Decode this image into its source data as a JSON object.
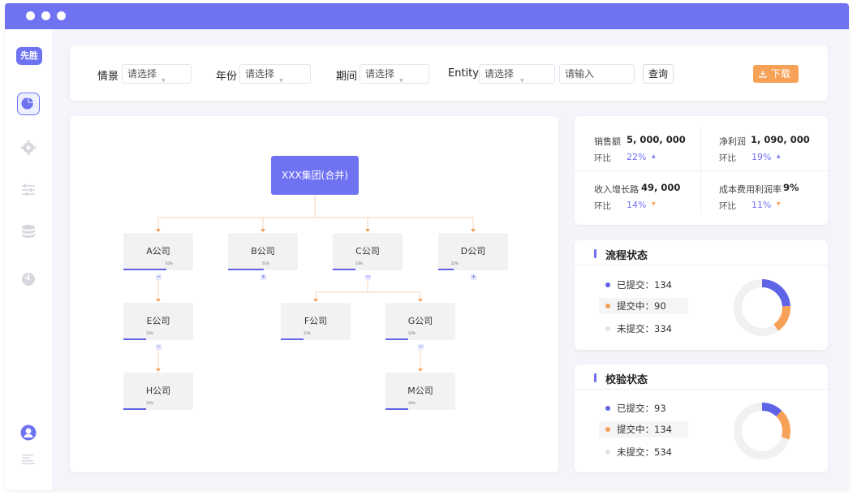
{
  "app": {
    "logo_text": "先胜"
  },
  "filters": {
    "scene_label": "情景",
    "scene_placeholder": "请选择",
    "year_label": "年份",
    "year_placeholder": "请选择",
    "period_label": "期间",
    "period_placeholder": "请选择",
    "entity_label": "Entity",
    "entity_placeholder": "请选择",
    "text_placeholder": "请输入",
    "query_label": "查询",
    "download_label": "下载"
  },
  "org": {
    "root": "XXX集团(合并)",
    "nodes": [
      {
        "id": "A",
        "label": "A公司",
        "pct_text": "62%",
        "progress": 0.62,
        "toggle": "−"
      },
      {
        "id": "B",
        "label": "B公司",
        "pct_text": "51%",
        "progress": 0.51,
        "toggle": "+"
      },
      {
        "id": "C",
        "label": "C公司",
        "pct_text": "33%",
        "progress": 0.33,
        "toggle": "−"
      },
      {
        "id": "D",
        "label": "D公司",
        "pct_text": "22%",
        "progress": 0.22,
        "toggle": "+"
      },
      {
        "id": "E",
        "label": "E公司",
        "pct_text": "33%",
        "progress": 0.33,
        "toggle": "−"
      },
      {
        "id": "F",
        "label": "F公司",
        "pct_text": "33%",
        "progress": 0.33
      },
      {
        "id": "G",
        "label": "G公司",
        "pct_text": "33%",
        "progress": 0.33,
        "toggle": "−"
      },
      {
        "id": "H",
        "label": "H公司",
        "pct_text": "33%",
        "progress": 0.33
      },
      {
        "id": "M",
        "label": "M公司",
        "pct_text": "33%",
        "progress": 0.33
      }
    ]
  },
  "metrics": {
    "sales": {
      "label": "销售额",
      "value": "5, 000, 000",
      "compare_label": "环比",
      "pct": "22%",
      "trend": "▲",
      "trend_color": "#6f73f2"
    },
    "net_profit": {
      "label": "净利润",
      "value": "1, 090, 000",
      "compare_label": "环比",
      "pct": "19%",
      "trend": "▲",
      "trend_color": "#6f73f2"
    },
    "revenue_growth": {
      "label": "收入增长路",
      "value": "49, 000",
      "compare_label": "环比",
      "pct": "14%",
      "trend": "▼",
      "trend_color": "#f7a157"
    },
    "cost_profit_rate": {
      "label": "成本费用利润率",
      "value": "9%",
      "compare_label": "环比",
      "pct": "11%",
      "trend": "▼",
      "trend_color": "#f7a157"
    }
  },
  "process_status": {
    "title": "流程状态",
    "items": [
      {
        "label": "已提交：134",
        "color": "#5f63e8",
        "value": 134
      },
      {
        "label": "提交中：90",
        "color": "#f7a157",
        "value": 90
      },
      {
        "label": "未提交：334",
        "color": "#e3e3e3",
        "value": 334
      }
    ]
  },
  "validation_status": {
    "title": "校验状态",
    "items": [
      {
        "label": "已提交：93",
        "color": "#5f63e8",
        "value": 93
      },
      {
        "label": "提交中：134",
        "color": "#f7a157",
        "value": 134
      },
      {
        "label": "未提交：534",
        "color": "#e3e3e3",
        "value": 534
      }
    ]
  },
  "colors": {
    "accent": "#6f73f2",
    "orange": "#f7a157",
    "connector": "#f7a157"
  }
}
